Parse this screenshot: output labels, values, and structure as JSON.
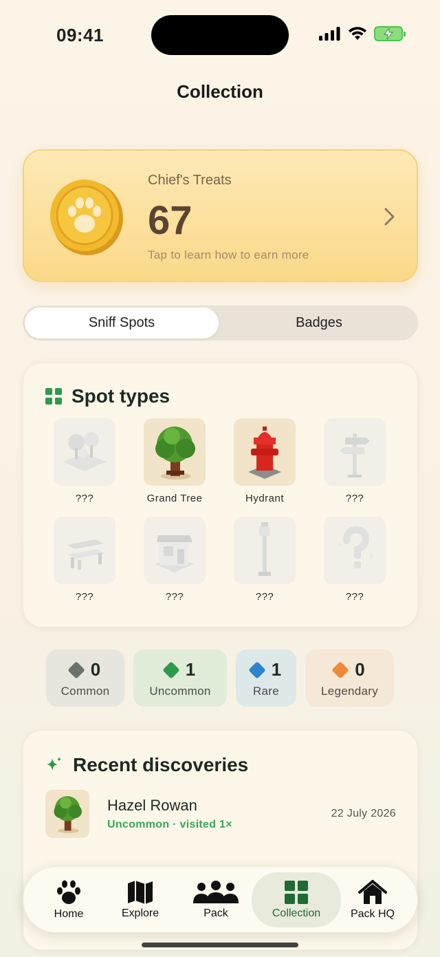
{
  "status_bar": {
    "time": "09:41"
  },
  "page": {
    "title": "Collection"
  },
  "treats": {
    "label": "Chief's Treats",
    "count": "67",
    "hint": "Tap to learn how to earn more"
  },
  "segments": {
    "active": "Sniff Spots",
    "inactive": "Badges"
  },
  "spot_types": {
    "title": "Spot types",
    "items": [
      {
        "name": "???",
        "icon": "park-trees-icon",
        "found": false
      },
      {
        "name": "Grand Tree",
        "icon": "grand-tree-icon",
        "found": true
      },
      {
        "name": "Hydrant",
        "icon": "hydrant-icon",
        "found": true
      },
      {
        "name": "???",
        "icon": "signpost-icon",
        "found": false
      },
      {
        "name": "???",
        "icon": "bench-icon",
        "found": false
      },
      {
        "name": "???",
        "icon": "shop-icon",
        "found": false
      },
      {
        "name": "???",
        "icon": "lamp-post-icon",
        "found": false
      },
      {
        "name": "???",
        "icon": "mystery-icon",
        "found": false
      }
    ]
  },
  "rarity": [
    {
      "count": "0",
      "label": "Common",
      "color": "#6b716e",
      "bg": "#e7e6de"
    },
    {
      "count": "1",
      "label": "Uncommon",
      "color": "#2f9a4b",
      "bg": "#e0ecd8"
    },
    {
      "count": "1",
      "label": "Rare",
      "color": "#2b84cc",
      "bg": "#dde8e8"
    },
    {
      "count": "0",
      "label": "Legendary",
      "color": "#ef8a3a",
      "bg": "#f6e8d6"
    }
  ],
  "recent": {
    "title": "Recent discoveries",
    "items": [
      {
        "title": "Hazel Rowan",
        "subtitle": "Uncommon · visited 1×",
        "date": "22 July 2026"
      }
    ]
  },
  "tabs": [
    {
      "label": "Home",
      "icon": "paw-icon"
    },
    {
      "label": "Explore",
      "icon": "map-icon"
    },
    {
      "label": "Pack",
      "icon": "pack-icon"
    },
    {
      "label": "Collection",
      "icon": "collection-grid-icon"
    },
    {
      "label": "Pack HQ",
      "icon": "house-icon"
    }
  ],
  "colors": {
    "accent": "#2f9a4b",
    "coin": "#f3b92d",
    "treat_text": "#5c4432"
  }
}
